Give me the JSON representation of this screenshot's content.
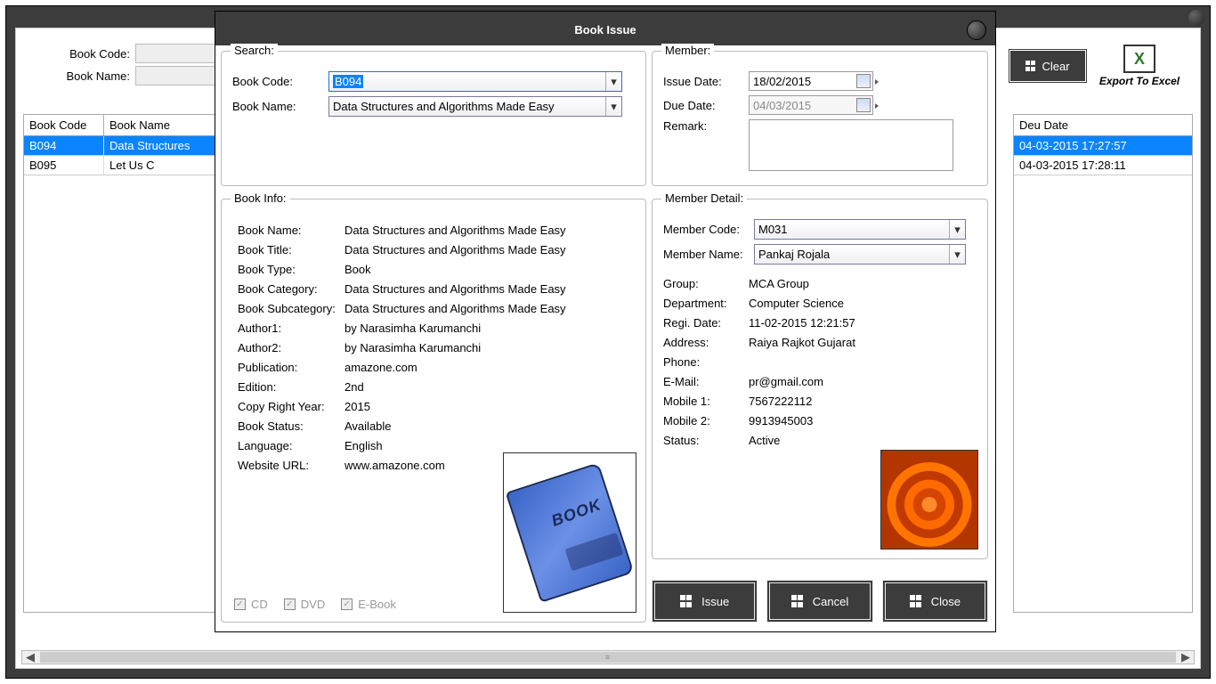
{
  "bg": {
    "labels": {
      "book_code": "Book Code:",
      "book_name": "Book Name:"
    },
    "clear_label": "Clear",
    "export_label": "Export To Excel",
    "table": {
      "headers": {
        "code": "Book Code",
        "name": "Book Name"
      },
      "rows": [
        {
          "code": "B094",
          "name": "Data Structures"
        },
        {
          "code": "B095",
          "name": "Let Us C"
        }
      ]
    },
    "due_table": {
      "header": "Deu Date",
      "rows": [
        "04-03-2015 17:27:57",
        "04-03-2015 17:28:11"
      ]
    }
  },
  "dialog": {
    "title": "Book Issue",
    "search": {
      "group": "Search:",
      "book_code_lbl": "Book Code:",
      "book_code_val": "B094",
      "book_name_lbl": "Book Name:",
      "book_name_val": "Data Structures and Algorithms Made Easy"
    },
    "member": {
      "group": "Member:",
      "issue_date_lbl": "Issue Date:",
      "issue_date": "18/02/2015",
      "due_date_lbl": "Due Date:",
      "due_date": "04/03/2015",
      "remark_lbl": "Remark:",
      "remark": ""
    },
    "book_info": {
      "group": "Book Info:",
      "rows": {
        "book_name": {
          "lbl": "Book Name:",
          "val": "Data Structures and Algorithms Made Easy"
        },
        "book_title": {
          "lbl": "Book Title:",
          "val": "Data Structures and Algorithms Made Easy"
        },
        "book_type": {
          "lbl": "Book Type:",
          "val": "Book"
        },
        "book_category": {
          "lbl": "Book Category:",
          "val": "Data Structures and Algorithms Made Easy"
        },
        "book_subcategory": {
          "lbl": "Book Subcategory:",
          "val": "Data Structures and Algorithms Made Easy"
        },
        "author1": {
          "lbl": "Author1:",
          "val": "by Narasimha Karumanchi"
        },
        "author2": {
          "lbl": "Author2:",
          "val": "by Narasimha Karumanchi"
        },
        "publication": {
          "lbl": "Publication:",
          "val": "amazone.com"
        },
        "edition": {
          "lbl": "Edition:",
          "val": "2nd"
        },
        "copyright": {
          "lbl": "Copy Right Year:",
          "val": "2015"
        },
        "status": {
          "lbl": "Book Status:",
          "val": "Available"
        },
        "language": {
          "lbl": "Language:",
          "val": "English"
        },
        "website": {
          "lbl": "Website URL:",
          "val": "www.amazone.com"
        }
      },
      "checks": {
        "cd": "CD",
        "dvd": "DVD",
        "ebook": "E-Book"
      },
      "book_word": "BOOK"
    },
    "member_detail": {
      "group": "Member Detail:",
      "member_code_lbl": "Member Code:",
      "member_code": "M031",
      "member_name_lbl": "Member Name:",
      "member_name": "Pankaj Rojala",
      "rows": {
        "group": {
          "lbl": "Group:",
          "val": "MCA Group"
        },
        "department": {
          "lbl": "Department:",
          "val": "Computer Science"
        },
        "regi_date": {
          "lbl": "Regi. Date:",
          "val": "11-02-2015 12:21:57"
        },
        "address": {
          "lbl": "Address:",
          "val": "Raiya Rajkot Gujarat"
        },
        "phone": {
          "lbl": "Phone:",
          "val": ""
        },
        "email": {
          "lbl": "E-Mail:",
          "val": "pr@gmail.com"
        },
        "mobile1": {
          "lbl": "Mobile 1:",
          "val": "7567222112"
        },
        "mobile2": {
          "lbl": "Mobile 2:",
          "val": "9913945003"
        },
        "status": {
          "lbl": "Status:",
          "val": "Active"
        }
      }
    },
    "actions": {
      "issue": "Issue",
      "cancel": "Cancel",
      "close": "Close"
    }
  }
}
